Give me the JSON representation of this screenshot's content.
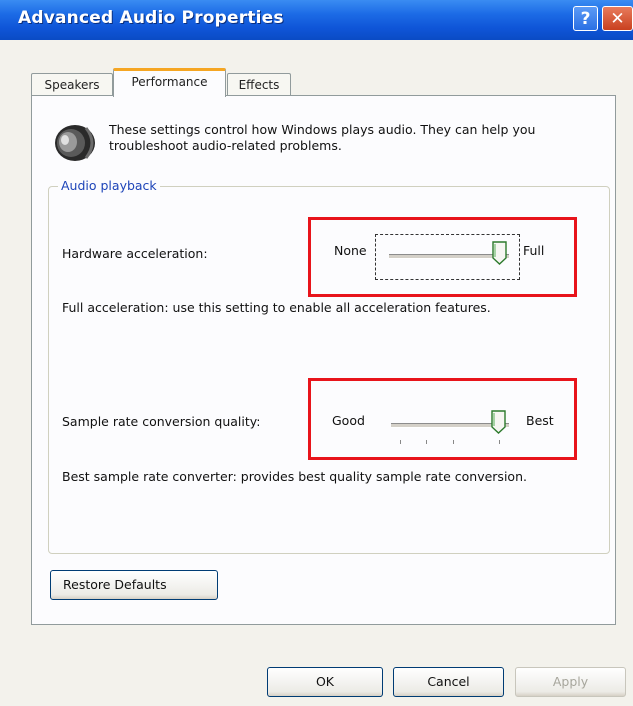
{
  "window": {
    "title": "Advanced Audio Properties",
    "help_glyph": "?",
    "close_glyph": "✕"
  },
  "tabs": [
    {
      "label": "Speakers"
    },
    {
      "label": "Performance",
      "selected": true
    },
    {
      "label": "Effects"
    }
  ],
  "intro": {
    "text": "These settings control how Windows plays audio. They can help you troubleshoot audio-related problems."
  },
  "group": {
    "label": "Audio playback"
  },
  "hardware_acceleration": {
    "label": "Hardware acceleration:",
    "min_label": "None",
    "max_label": "Full",
    "level": 1.0,
    "description": "Full acceleration: use this setting to enable all acceleration features."
  },
  "sample_rate": {
    "label": "Sample rate conversion quality:",
    "min_label": "Good",
    "max_label": "Best",
    "level": 1.0,
    "description": "Best sample rate converter: provides best quality sample rate conversion."
  },
  "buttons": {
    "restore": "Restore Defaults",
    "ok": "OK",
    "cancel": "Cancel",
    "apply": "Apply"
  },
  "colors": {
    "highlight": "#e8141b",
    "titlebar": "#0f55d8",
    "selected_tab_accent": "#f5a623",
    "group_label": "#1d44b8"
  }
}
